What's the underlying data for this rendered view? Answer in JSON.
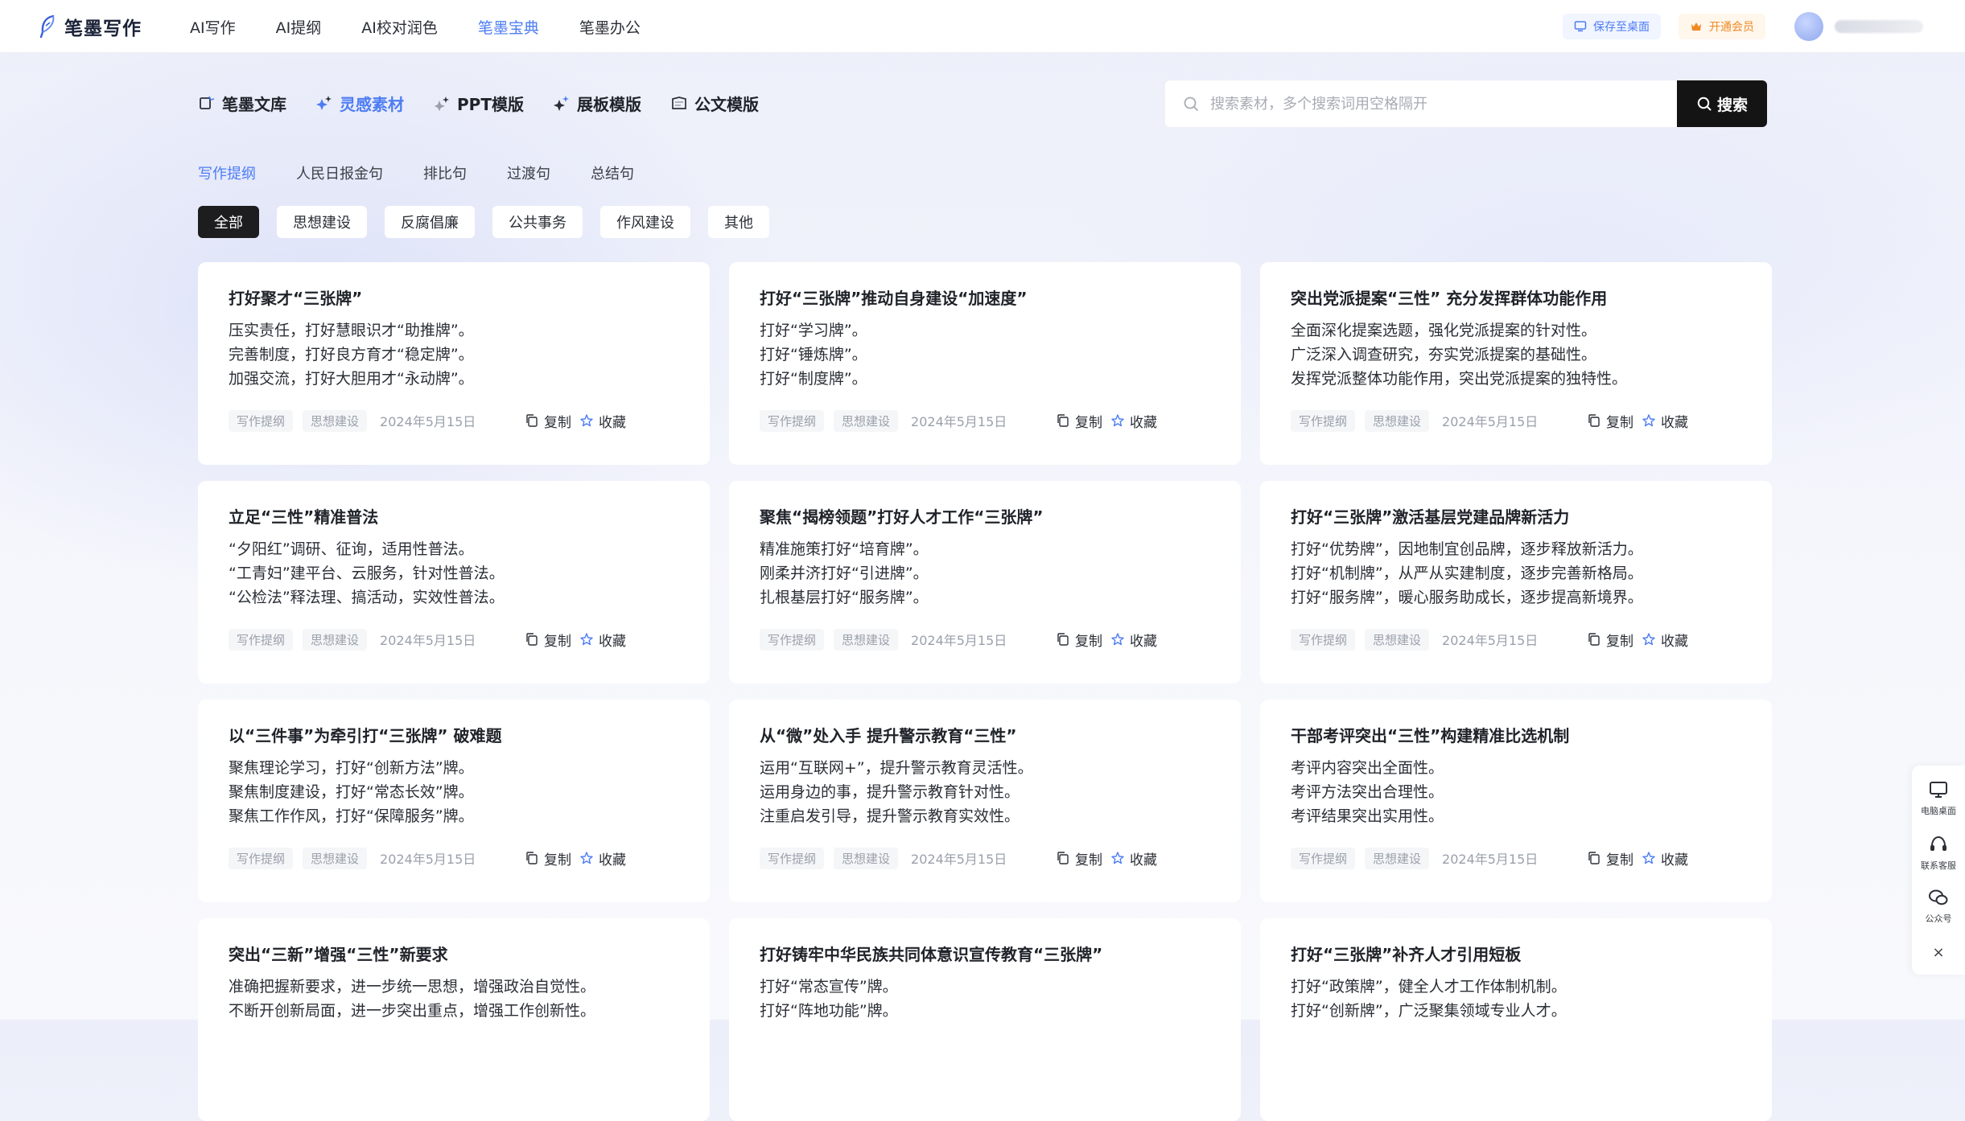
{
  "brand": {
    "name": "笔墨写作"
  },
  "nav": {
    "links": [
      {
        "label": "AI写作",
        "active": false
      },
      {
        "label": "AI提纲",
        "active": false
      },
      {
        "label": "AI校对润色",
        "active": false
      },
      {
        "label": "笔墨宝典",
        "active": true
      },
      {
        "label": "笔墨办公",
        "active": false
      }
    ],
    "save_desktop": "保存至桌面",
    "vip": "开通会员"
  },
  "categories": [
    {
      "label": "笔墨文库",
      "icon": "library-icon",
      "active": false
    },
    {
      "label": "灵感素材",
      "icon": "sparkle-icon",
      "active": true
    },
    {
      "label": "PPT模版",
      "icon": "ppt-icon",
      "active": false
    },
    {
      "label": "展板模版",
      "icon": "board-icon",
      "active": false
    },
    {
      "label": "公文模版",
      "icon": "document-icon",
      "active": false
    }
  ],
  "search": {
    "placeholder": "搜索素材，多个搜索词用空格隔开",
    "button": "搜索"
  },
  "subtabs": [
    {
      "label": "写作提纲",
      "active": true
    },
    {
      "label": "人民日报金句",
      "active": false
    },
    {
      "label": "排比句",
      "active": false
    },
    {
      "label": "过渡句",
      "active": false
    },
    {
      "label": "总结句",
      "active": false
    }
  ],
  "filters": [
    {
      "label": "全部",
      "active": true
    },
    {
      "label": "思想建设",
      "active": false
    },
    {
      "label": "反腐倡廉",
      "active": false
    },
    {
      "label": "公共事务",
      "active": false
    },
    {
      "label": "作风建设",
      "active": false
    },
    {
      "label": "其他",
      "active": false
    }
  ],
  "card_actions": {
    "copy": "复制",
    "collect": "收藏"
  },
  "cards": [
    {
      "title": "打好聚才“三张牌”",
      "lines": [
        "压实责任，打好慧眼识才“助推牌”。",
        "完善制度，打好良方育才“稳定牌”。",
        "加强交流，打好大胆用才“永动牌”。"
      ],
      "tags": [
        "写作提纲",
        "思想建设"
      ],
      "date": "2024年5月15日"
    },
    {
      "title": "打好“三张牌”推动自身建设“加速度”",
      "lines": [
        "打好“学习牌”。",
        "打好“锤炼牌”。",
        "打好“制度牌”。"
      ],
      "tags": [
        "写作提纲",
        "思想建设"
      ],
      "date": "2024年5月15日"
    },
    {
      "title": "突出党派提案“三性” 充分发挥群体功能作用",
      "lines": [
        "全面深化提案选题，强化党派提案的针对性。",
        "广泛深入调查研究，夯实党派提案的基础性。",
        "发挥党派整体功能作用，突出党派提案的独特性。"
      ],
      "tags": [
        "写作提纲",
        "思想建设"
      ],
      "date": "2024年5月15日"
    },
    {
      "title": "立足“三性”精准普法",
      "lines": [
        "“夕阳红”调研、征询，适用性普法。",
        "“工青妇”建平台、云服务，针对性普法。",
        "“公检法”释法理、搞活动，实效性普法。"
      ],
      "tags": [
        "写作提纲",
        "思想建设"
      ],
      "date": "2024年5月15日"
    },
    {
      "title": "聚焦“揭榜领题”打好人才工作“三张牌”",
      "lines": [
        "精准施策打好“培育牌”。",
        "刚柔并济打好“引进牌”。",
        "扎根基层打好“服务牌”。"
      ],
      "tags": [
        "写作提纲",
        "思想建设"
      ],
      "date": "2024年5月15日"
    },
    {
      "title": "打好“三张牌”激活基层党建品牌新活力",
      "lines": [
        "打好“优势牌”，因地制宜创品牌，逐步释放新活力。",
        "打好“机制牌”，从严从实建制度，逐步完善新格局。",
        "打好“服务牌”，暖心服务助成长，逐步提高新境界。"
      ],
      "tags": [
        "写作提纲",
        "思想建设"
      ],
      "date": "2024年5月15日"
    },
    {
      "title": "以“三件事”为牵引打“三张牌” 破难题",
      "lines": [
        "聚焦理论学习，打好“创新方法”牌。",
        "聚焦制度建设，打好“常态长效”牌。",
        "聚焦工作作风，打好“保障服务”牌。"
      ],
      "tags": [
        "写作提纲",
        "思想建设"
      ],
      "date": "2024年5月15日"
    },
    {
      "title": "从“微”处入手 提升警示教育“三性”",
      "lines": [
        "运用“互联网+”，提升警示教育灵活性。",
        "运用身边的事，提升警示教育针对性。",
        "注重启发引导，提升警示教育实效性。"
      ],
      "tags": [
        "写作提纲",
        "思想建设"
      ],
      "date": "2024年5月15日"
    },
    {
      "title": "干部考评突出“三性”构建精准比选机制",
      "lines": [
        "考评内容突出全面性。",
        "考评方法突出合理性。",
        "考评结果突出实用性。"
      ],
      "tags": [
        "写作提纲",
        "思想建设"
      ],
      "date": "2024年5月15日"
    },
    {
      "title": "突出“三新”增强“三性”新要求",
      "lines": [
        "准确把握新要求，进一步统一思想，增强政治自觉性。",
        "不断开创新局面，进一步突出重点，增强工作创新性。"
      ],
      "tags": [],
      "date": ""
    },
    {
      "title": "打好铸牢中华民族共同体意识宣传教育“三张牌”",
      "lines": [
        "打好“常态宣传”牌。",
        "打好“阵地功能”牌。"
      ],
      "tags": [],
      "date": ""
    },
    {
      "title": "打好“三张牌”补齐人才引用短板",
      "lines": [
        "打好“政策牌”，健全人才工作体制机制。",
        "打好“创新牌”，广泛聚集领域专业人才。"
      ],
      "tags": [],
      "date": ""
    }
  ],
  "floatbar": {
    "desktop": "电脑桌面",
    "service": "联系客服",
    "wechat": "公众号",
    "close": "×"
  },
  "colors": {
    "accent": "#4d7cf4",
    "dark_button": "#141414",
    "vip": "#ef8a23"
  }
}
